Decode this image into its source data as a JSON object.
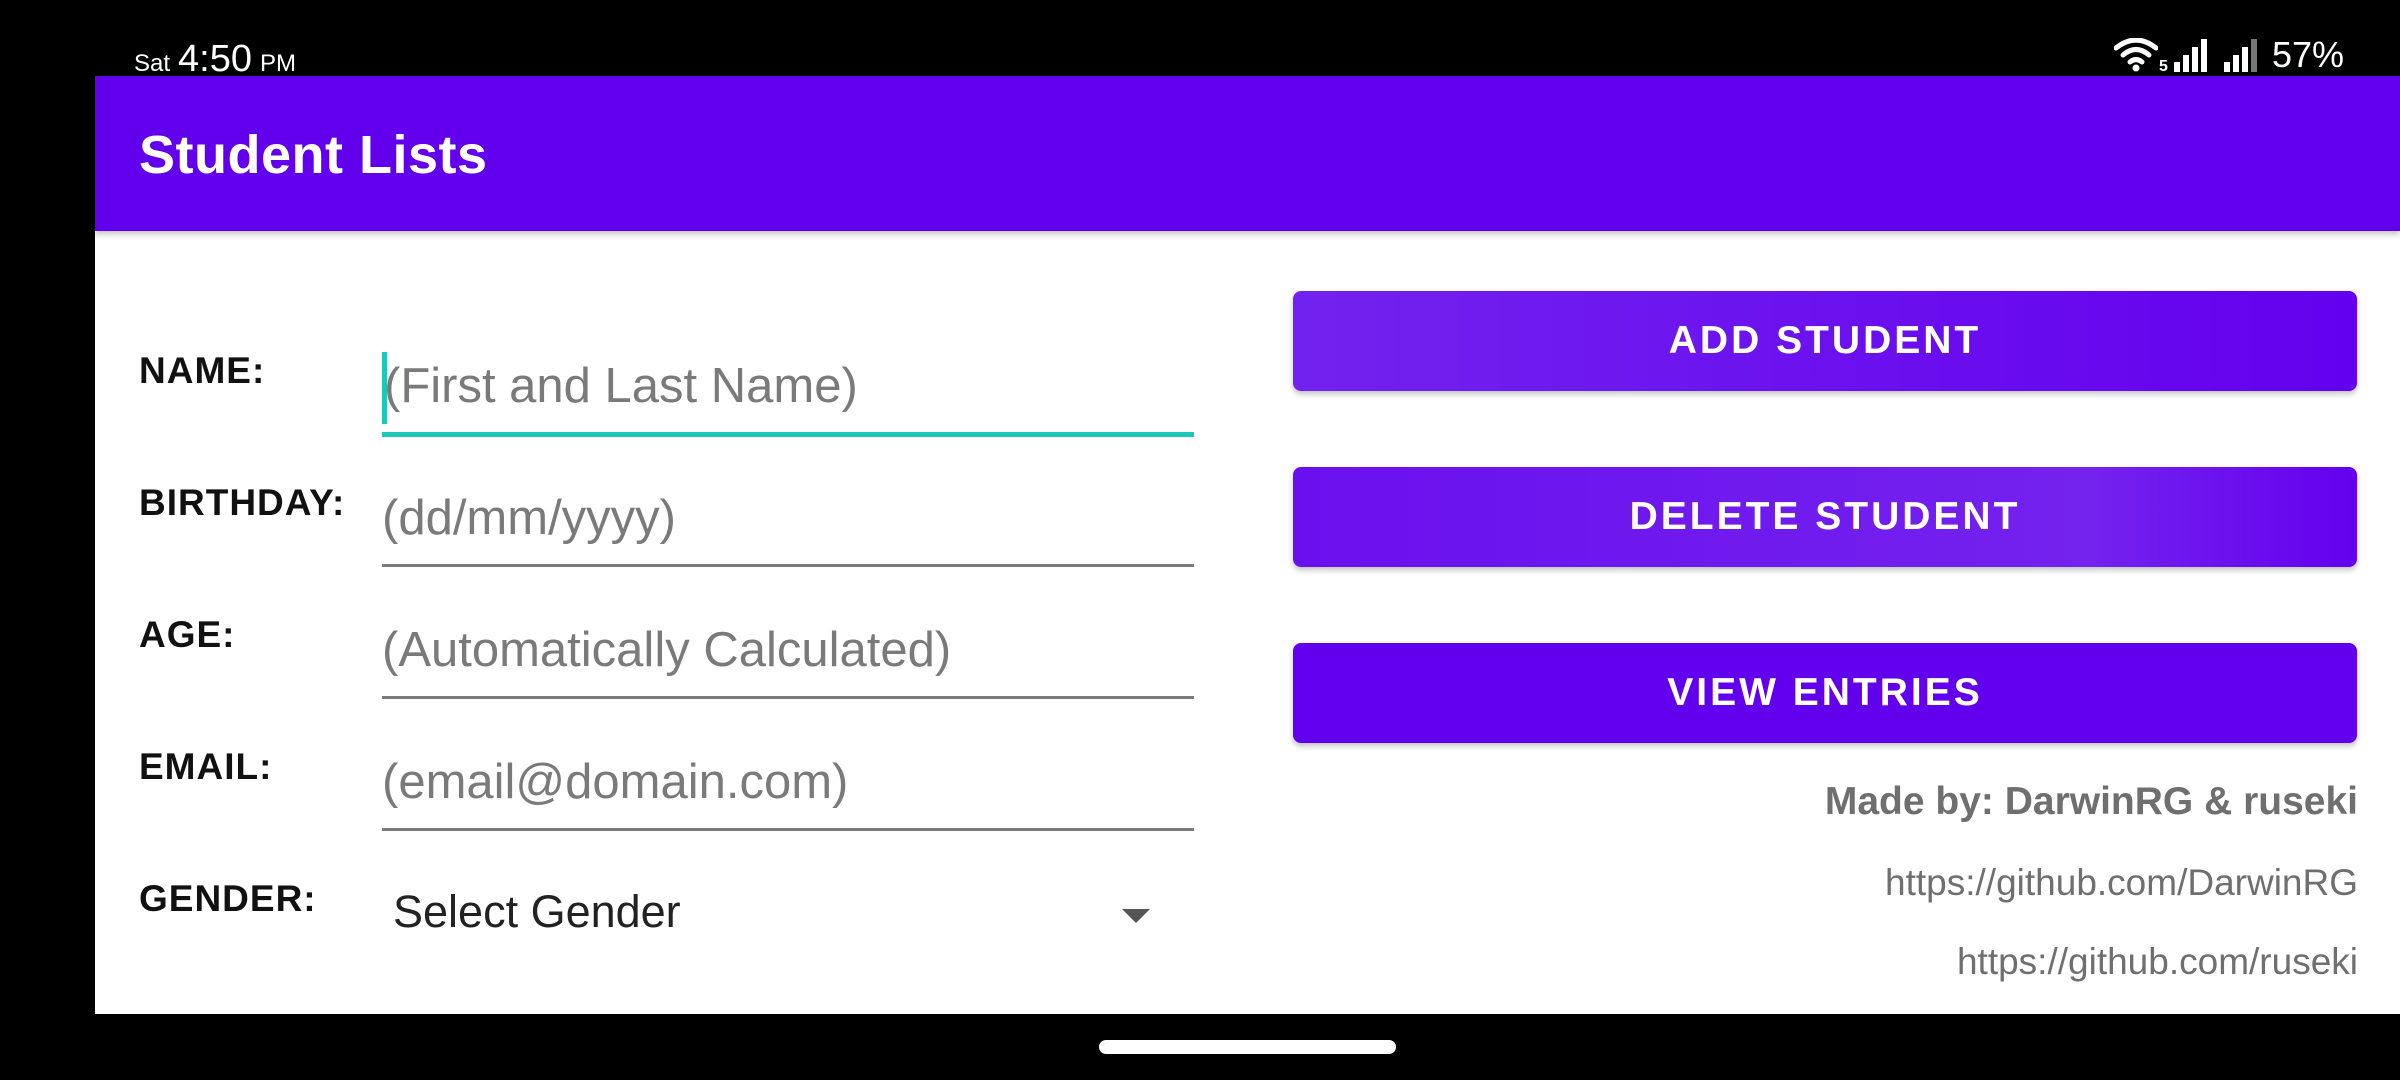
{
  "status_bar": {
    "day": "Sat",
    "time": "4:50",
    "ampm": "PM",
    "battery": "57%",
    "network_badge": "5",
    "icons": [
      "wifi-icon",
      "signal-icon",
      "signal-icon",
      "battery"
    ]
  },
  "app_bar": {
    "title": "Student Lists"
  },
  "form": {
    "name": {
      "label": "NAME:",
      "placeholder": "(First and Last Name)"
    },
    "birthday": {
      "label": "BIRTHDAY:",
      "placeholder": "(dd/mm/yyyy)"
    },
    "age": {
      "label": "AGE:",
      "placeholder": "(Automatically Calculated)"
    },
    "email": {
      "label": "EMAIL:",
      "placeholder": "(email@domain.com)"
    },
    "gender": {
      "label": "GENDER:",
      "selected": "Select Gender"
    }
  },
  "buttons": {
    "add": "ADD STUDENT",
    "delete": "DELETE STUDENT",
    "view": "VIEW ENTRIES"
  },
  "credits": {
    "made_by": "Made by: DarwinRG & ruseki",
    "link1": "https://github.com/DarwinRG",
    "link2": "https://github.com/ruseki"
  },
  "colors": {
    "primary": "#6200EE",
    "accent": "#1CC8B8",
    "hint": "#7A7A7A"
  }
}
